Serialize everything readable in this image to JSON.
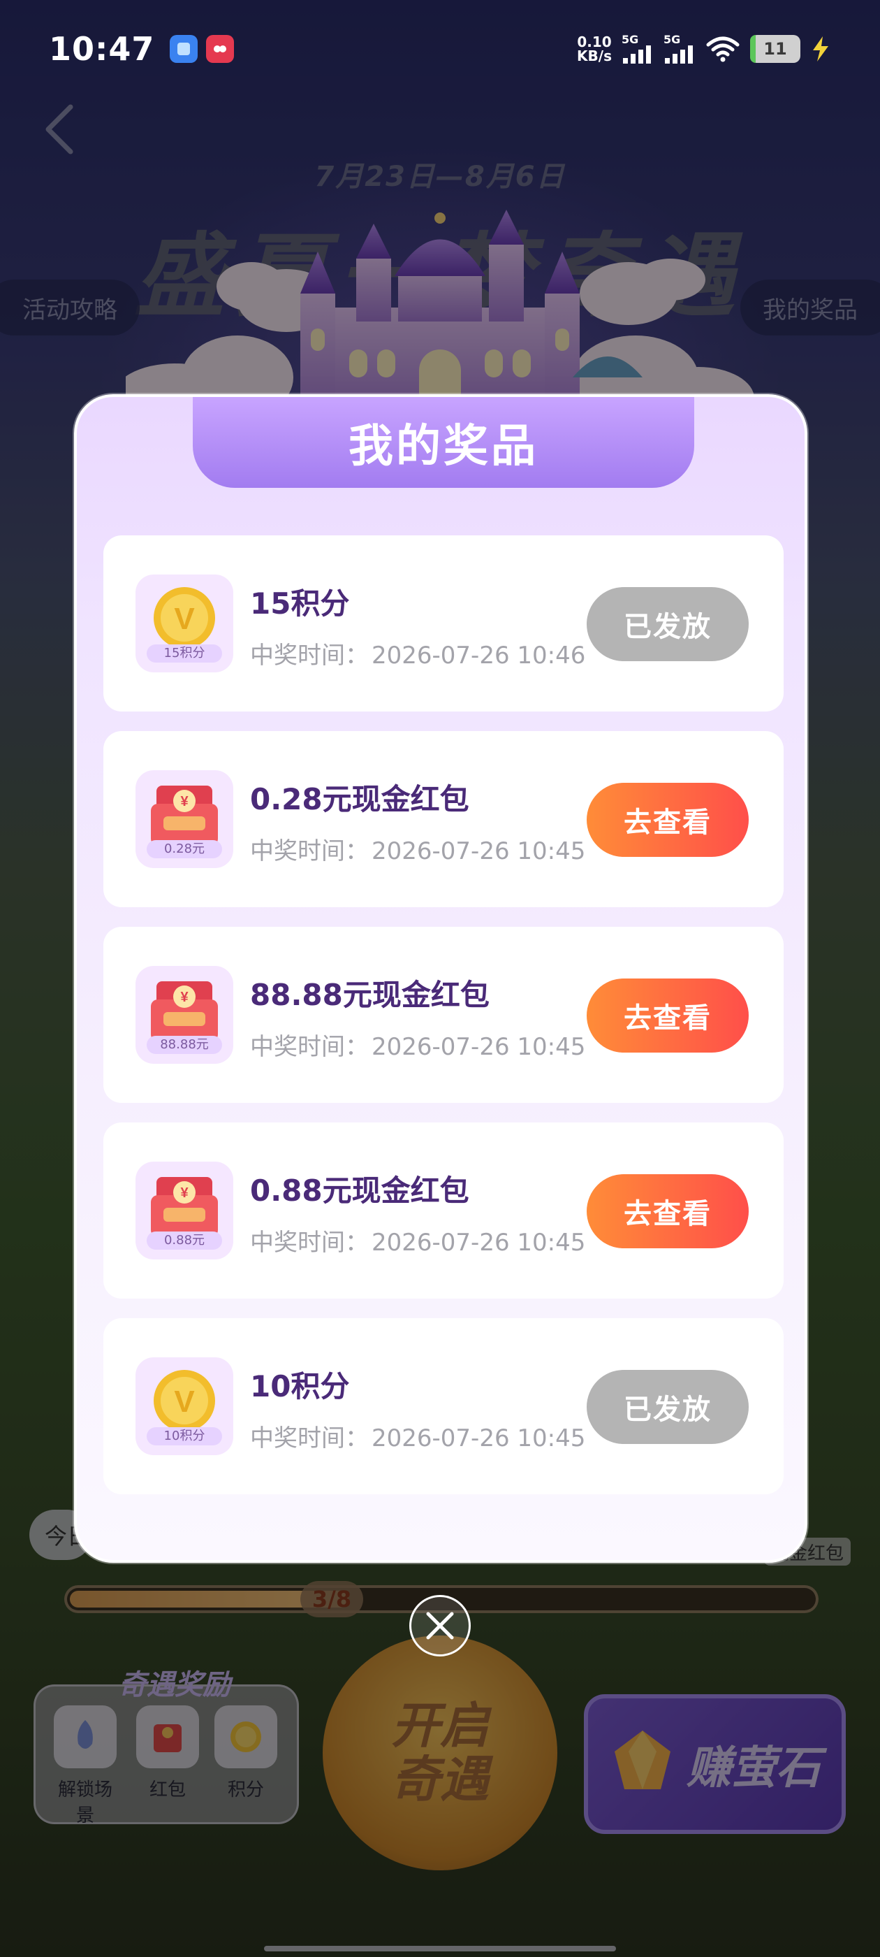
{
  "status_bar": {
    "time": "10:47",
    "net_speed_value": "0.10",
    "net_speed_unit": "KB/s",
    "sim1_label": "5G",
    "sim2_label": "5G",
    "battery_level": "11",
    "battery_fraction": 0.11
  },
  "background": {
    "event_dates": "7月23日—8月6日",
    "event_title": "盛夏一梦奇遇",
    "left_pill": "活动攻略",
    "right_pill": "我的奖品",
    "today_bubble": "今日",
    "right_tag": "现金红包",
    "progress_text": "3/8",
    "progress_fraction": 0.375,
    "reward_title": "奇遇奖励",
    "reward_items": [
      {
        "label": "解锁场景"
      },
      {
        "label": "红包"
      },
      {
        "label": "积分"
      }
    ],
    "open_button_line1": "开启",
    "open_button_line2": "奇遇",
    "earn_button": "赚萤石"
  },
  "modal": {
    "title": "我的奖品",
    "time_label": "中奖时间：",
    "prizes": [
      {
        "type": "points",
        "icon_label": "15积分",
        "name": "15积分",
        "time": "2026-07-26 10:46",
        "button": "已发放",
        "button_state": "done"
      },
      {
        "type": "cash",
        "icon_label": "0.28元",
        "name": "0.28元现金红包",
        "time": "2026-07-26 10:45",
        "button": "去查看",
        "button_state": "view"
      },
      {
        "type": "cash",
        "icon_label": "88.88元",
        "name": "88.88元现金红包",
        "time": "2026-07-26 10:45",
        "button": "去查看",
        "button_state": "view"
      },
      {
        "type": "cash",
        "icon_label": "0.88元",
        "name": "0.88元现金红包",
        "time": "2026-07-26 10:45",
        "button": "去查看",
        "button_state": "view"
      },
      {
        "type": "points",
        "icon_label": "10积分",
        "name": "10积分",
        "time": "2026-07-26 10:45",
        "button": "已发放",
        "button_state": "done"
      }
    ]
  },
  "colors": {
    "modal_header": "#a27cf0",
    "prize_name": "#4a2a78",
    "button_done": "#b4b4b4",
    "button_view_start": "#ff8c38",
    "button_view_end": "#ff4f4a"
  }
}
